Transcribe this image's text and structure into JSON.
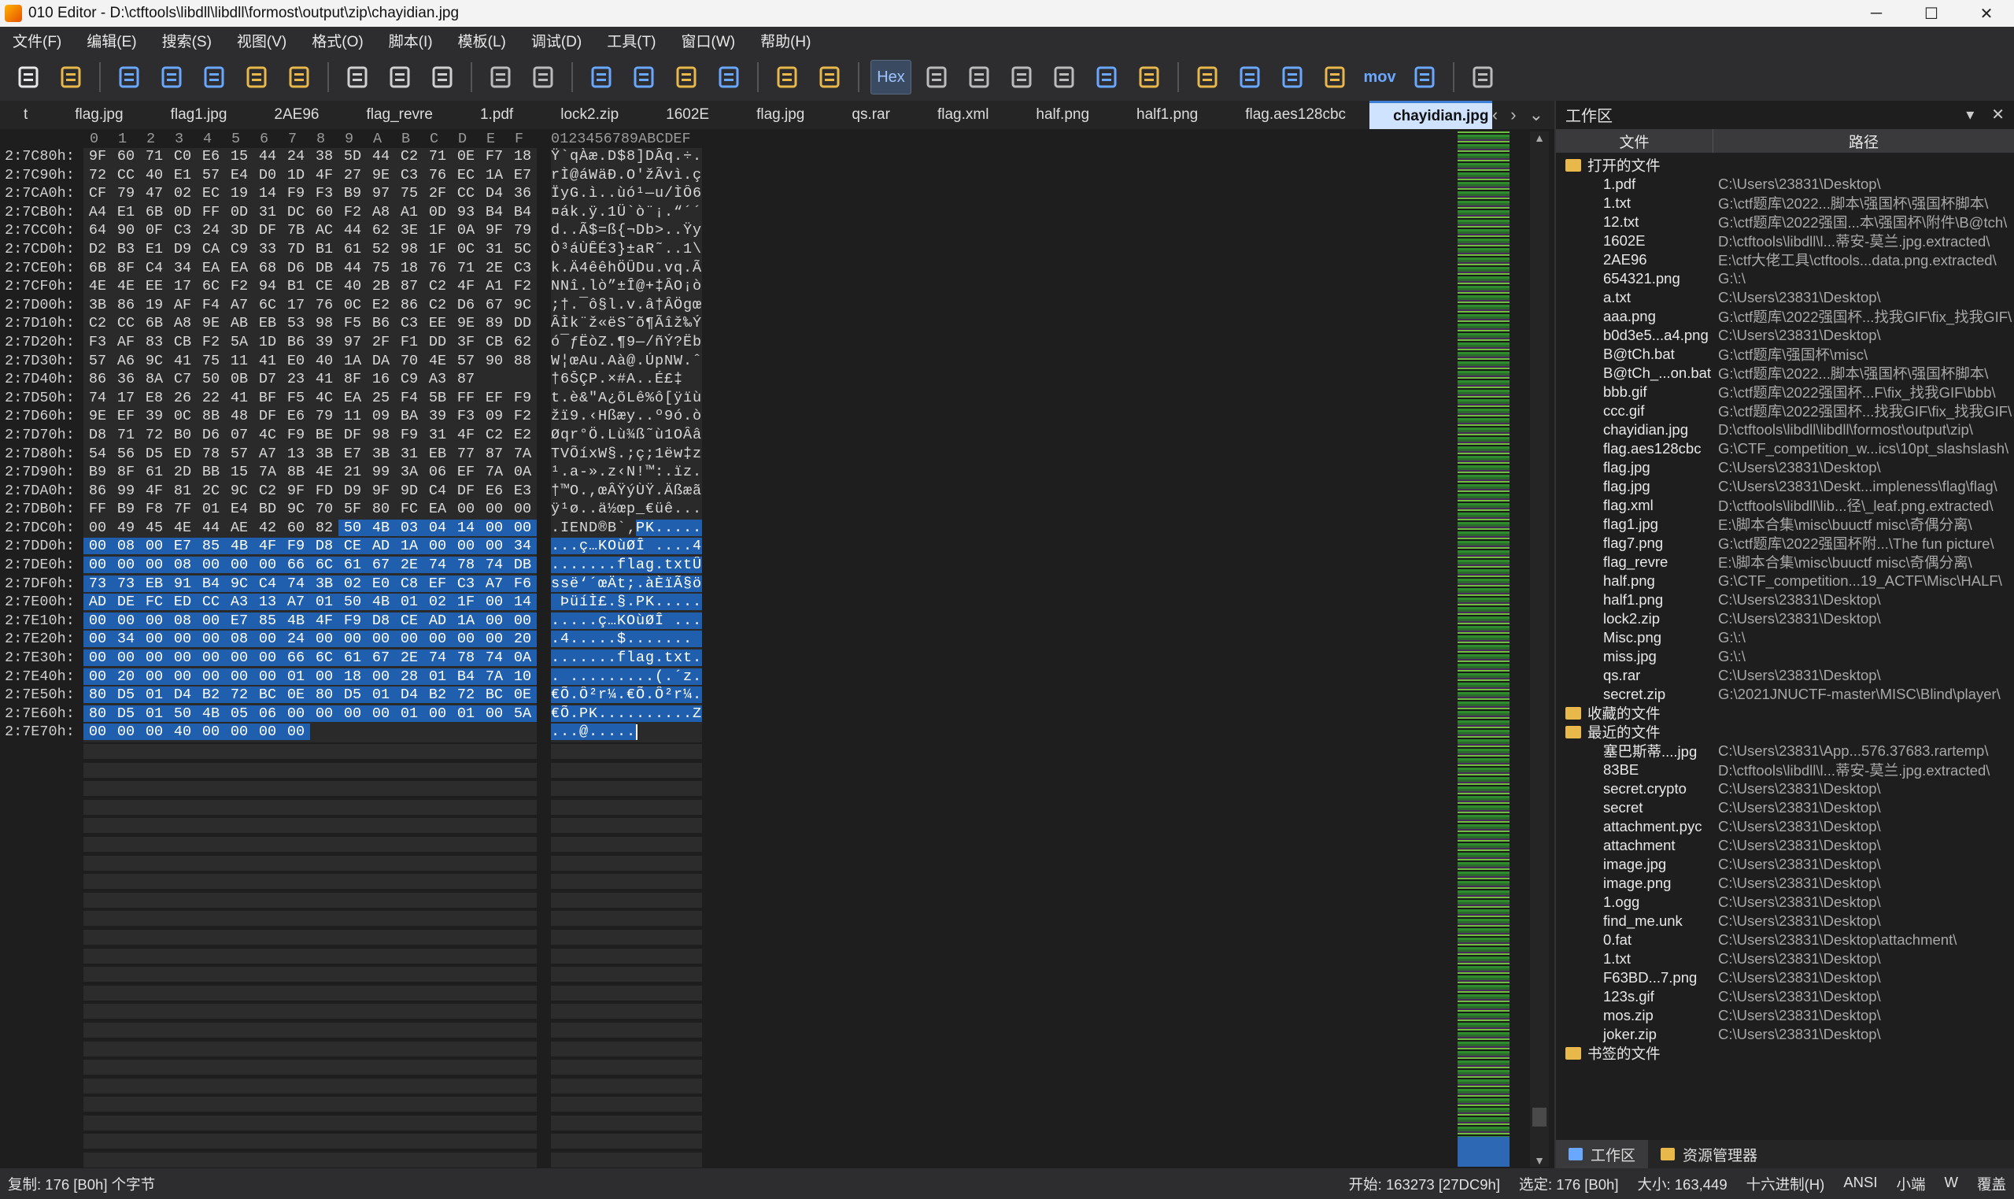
{
  "window": {
    "title": "010 Editor - D:\\ctftools\\libdll\\libdll\\formost\\output\\zip\\chayidian.jpg",
    "minimize": "─",
    "maximize": "☐",
    "close": "✕"
  },
  "menu": [
    "文件(F)",
    "编辑(E)",
    "搜索(S)",
    "视图(V)",
    "格式(O)",
    "脚本(I)",
    "模板(L)",
    "调试(D)",
    "工具(T)",
    "窗口(W)",
    "帮助(H)"
  ],
  "toolbar": {
    "hex_label": "Hex",
    "mov_label": "mov",
    "icons": [
      "new-file-icon",
      "open-folder-icon",
      "save-icon",
      "save-as-icon",
      "save-all-icon",
      "folder-icon",
      "open-workspace-icon",
      "cut-icon",
      "copy-icon",
      "paste-icon",
      "undo-icon",
      "redo-icon",
      "find-icon",
      "replace-icon",
      "goto-icon",
      "arrow-right-icon",
      "run-script-icon",
      "run-template-icon",
      "hex-mode-icon",
      "text-mode-icon",
      "paragraph-icon",
      "columns-icon",
      "highlight-icon",
      "calculator-icon",
      "inspector-icon",
      "compare-icon",
      "histogram-icon",
      "checksum-icon",
      "math-icon",
      "mov-icon",
      "base-convert-icon",
      "pause-icon"
    ]
  },
  "tabs": [
    {
      "label": "t",
      "active": false
    },
    {
      "label": "flag.jpg",
      "active": false
    },
    {
      "label": "flag1.jpg",
      "active": false
    },
    {
      "label": "2AE96",
      "active": false
    },
    {
      "label": "flag_revre",
      "active": false
    },
    {
      "label": "1.pdf",
      "active": false
    },
    {
      "label": "lock2.zip",
      "active": false
    },
    {
      "label": "1602E",
      "active": false
    },
    {
      "label": "flag.jpg",
      "active": false
    },
    {
      "label": "qs.rar",
      "active": false
    },
    {
      "label": "flag.xml",
      "active": false
    },
    {
      "label": "half.png",
      "active": false
    },
    {
      "label": "half1.png",
      "active": false
    },
    {
      "label": "flag.aes128cbc",
      "active": false
    },
    {
      "label": "chayidian.jpg",
      "active": true
    }
  ],
  "hex": {
    "column_headers": [
      "0",
      "1",
      "2",
      "3",
      "4",
      "5",
      "6",
      "7",
      "8",
      "9",
      "A",
      "B",
      "C",
      "D",
      "E",
      "F"
    ],
    "ascii_header": "0123456789ABCDEF",
    "rows": [
      {
        "addr": "2:7C80h:",
        "bytes": "9F 60 71 C0 E6 15 44 24 38 5D 44 C2 71 0E F7 18",
        "ascii": "Ÿ`qÀæ.D$8]DÂq.÷.",
        "sel_from": -1
      },
      {
        "addr": "2:7C90h:",
        "bytes": "72 CC 40 E1 57 E4 D0 1D 4F 27 9E C3 76 EC 1A E7",
        "ascii": "rÌ@áWäÐ.O'žÃvì.ç",
        "sel_from": -1
      },
      {
        "addr": "2:7CA0h:",
        "bytes": "CF 79 47 02 EC 19 14 F9 F3 B9 97 75 2F CC D4 36",
        "ascii": "ÏyG.ì..ùó¹—u/ÌÔ6",
        "sel_from": -1
      },
      {
        "addr": "2:7CB0h:",
        "bytes": "A4 E1 6B 0D FF 0D 31 DC 60 F2 A8 A1 0D 93 B4 B4",
        "ascii": "¤ák.ÿ.1Ü`ò¨¡.“´´",
        "sel_from": -1
      },
      {
        "addr": "2:7CC0h:",
        "bytes": "64 90 0F C3 24 3D DF 7B AC 44 62 3E 1F 0A 9F 79",
        "ascii": "d..Ã$=ß{¬Db>..Ÿy",
        "sel_from": -1
      },
      {
        "addr": "2:7CD0h:",
        "bytes": "D2 B3 E1 D9 CA C9 33 7D B1 61 52 98 1F 0C 31 5C",
        "ascii": "Ò³áÙÊÉ3}±aR˜..1\\",
        "sel_from": -1
      },
      {
        "addr": "2:7CE0h:",
        "bytes": "6B 8F C4 34 EA EA 68 D6 DB 44 75 18 76 71 2E C3",
        "ascii": "k.Ä4êêhÖÛDu.vq.Ã",
        "sel_from": -1
      },
      {
        "addr": "2:7CF0h:",
        "bytes": "4E 4E EE 17 6C F2 94 B1 CE 40 2B 87 C2 4F A1 F2",
        "ascii": "NNî.lò”±Î@+‡ÂO¡ò",
        "sel_from": -1
      },
      {
        "addr": "2:7D00h:",
        "bytes": "3B 86 19 AF F4 A7 6C 17 76 0C E2 86 C2 D6 67 9C",
        "ascii": ";†.¯ô§l.v.â†ÂÖgœ",
        "sel_from": -1
      },
      {
        "addr": "2:7D10h:",
        "bytes": "C2 CC 6B A8 9E AB EB 53 98 F5 B6 C3 EE 9E 89 DD",
        "ascii": "ÂÌk¨ž«ëS˜õ¶Ãîž‰Ý",
        "sel_from": -1
      },
      {
        "addr": "2:7D20h:",
        "bytes": "F3 AF 83 CB F2 5A 1D B6 39 97 2F F1 DD 3F CB 62",
        "ascii": "ó¯ƒËòZ.¶9—/ñÝ?Ëb",
        "sel_from": -1
      },
      {
        "addr": "2:7D30h:",
        "bytes": "57 A6 9C 41 75 11 41 E0 40 1A DA 70 4E 57 90 88",
        "ascii": "W¦œAu.Aà@.ÚpNW.ˆ",
        "sel_from": -1
      },
      {
        "addr": "2:7D40h:",
        "bytes": "86 36 8A C7 50 0B D7 23 41 8F 16 C9 A3 87",
        "ascii": "†6ŠÇP.×#A..É£‡",
        "sel_from": -1
      },
      {
        "addr": "2:7D50h:",
        "bytes": "74 17 E8 26 22 41 BF F5 4C EA 25 F4 5B FF EF F9",
        "ascii": "t.è&\"A¿õLê%ô[ÿïù",
        "sel_from": -1
      },
      {
        "addr": "2:7D60h:",
        "bytes": "9E EF 39 0C 8B 48 DF E6 79 11 09 BA 39 F3 09 F2",
        "ascii": "žï9.‹Hßæy..º9ó.ò",
        "sel_from": -1
      },
      {
        "addr": "2:7D70h:",
        "bytes": "D8 71 72 B0 D6 07 4C F9 BE DF 98 F9 31 4F C2 E2",
        "ascii": "Øqr°Ö.Lù¾ß˜ù1OÂâ",
        "sel_from": -1
      },
      {
        "addr": "2:7D80h:",
        "bytes": "54 56 D5 ED 78 57 A7 13 3B E7 3B 31 EB 77 87 7A",
        "ascii": "TVÕíxW§.;ç;1ëw‡z",
        "sel_from": -1
      },
      {
        "addr": "2:7D90h:",
        "bytes": "B9 8F 61 2D BB 15 7A 8B 4E 21 99 3A 06 EF 7A 0A",
        "ascii": "¹.a-».z‹N!™:.ïz.",
        "sel_from": -1
      },
      {
        "addr": "2:7DA0h:",
        "bytes": "86 99 4F 81 2C 9C C2 9F FD D9 9F 9D C4 DF E6 E3",
        "ascii": "†™O.,œÂŸýÙŸ.Äßæã",
        "sel_from": -1
      },
      {
        "addr": "2:7DB0h:",
        "bytes": "FF B9 F8 7F 01 E4 BD 9C 70 5F 80 FC EA 00 00 00",
        "ascii": "ÿ¹ø..ä½œp_€üê...",
        "sel_from": -1
      },
      {
        "addr": "2:7DC0h:",
        "bytes": "00 49 45 4E 44 AE 42 60 82 50 4B 03 04 14 00 00",
        "ascii": ".IEND®B`‚PK.....",
        "sel_from": 9
      },
      {
        "addr": "2:7DD0h:",
        "bytes": "00 08 00 E7 85 4B 4F F9 D8 CE AD 1A 00 00 00 34",
        "ascii": "...ç…KOùØÎ­....4",
        "sel_from": 0
      },
      {
        "addr": "2:7DE0h:",
        "bytes": "00 00 00 08 00 00 00 66 6C 61 67 2E 74 78 74 DB",
        "ascii": ".......flag.txtÛ",
        "sel_from": 0
      },
      {
        "addr": "2:7DF0h:",
        "bytes": "73 73 EB 91 B4 9C C4 74 3B 02 E0 C8 EF C3 A7 F6",
        "ascii": "ssë‘´œÄt;.àÈïÃ§ö",
        "sel_from": 0
      },
      {
        "addr": "2:7E00h:",
        "bytes": "AD DE FC ED CC A3 13 A7 01 50 4B 01 02 1F 00 14",
        "ascii": "­ÞüíÌ£.§.PK.....",
        "sel_from": 0
      },
      {
        "addr": "2:7E10h:",
        "bytes": "00 00 00 08 00 E7 85 4B 4F F9 D8 CE AD 1A 00 00",
        "ascii": ".....ç…KOùØÎ­...",
        "sel_from": 0
      },
      {
        "addr": "2:7E20h:",
        "bytes": "00 34 00 00 00 08 00 24 00 00 00 00 00 00 00 20",
        "ascii": ".4.....$....... ",
        "sel_from": 0
      },
      {
        "addr": "2:7E30h:",
        "bytes": "00 00 00 00 00 00 00 66 6C 61 67 2E 74 78 74 0A",
        "ascii": ".......flag.txt.",
        "sel_from": 0
      },
      {
        "addr": "2:7E40h:",
        "bytes": "00 20 00 00 00 00 00 01 00 18 00 28 01 B4 7A 10",
        "ascii": ". .........(.´z.",
        "sel_from": 0
      },
      {
        "addr": "2:7E50h:",
        "bytes": "80 D5 01 D4 B2 72 BC 0E 80 D5 01 D4 B2 72 BC 0E",
        "ascii": "€Õ.Ô²r¼.€Õ.Ô²r¼.",
        "sel_from": 0
      },
      {
        "addr": "2:7E60h:",
        "bytes": "80 D5 01 50 4B 05 06 00 00 00 00 01 00 01 00 5A",
        "ascii": "€Õ.PK..........Z",
        "sel_from": 0
      },
      {
        "addr": "2:7E70h:",
        "bytes": "00 00 00 40 00 00 00 00",
        "ascii": "...@.....",
        "sel_from": 0
      }
    ]
  },
  "workspace": {
    "title": "工作区",
    "col_name": "文件",
    "col_path": "路径",
    "open_files_label": "打开的文件",
    "open_files": [
      {
        "name": "1.pdf",
        "path": "C:\\Users\\23831\\Desktop\\"
      },
      {
        "name": "1.txt",
        "path": "G:\\ctf题库\\2022...脚本\\强国杯\\强国杯脚本\\"
      },
      {
        "name": "12.txt",
        "path": "G:\\ctf题库\\2022强国...本\\强国杯\\附件\\B@tch\\"
      },
      {
        "name": "1602E",
        "path": "D:\\ctftools\\libdll\\l...蒂安-莫兰.jpg.extracted\\"
      },
      {
        "name": "2AE96",
        "path": "E:\\ctf大佬工具\\ctftools...data.png.extracted\\"
      },
      {
        "name": "654321.png",
        "path": "G:\\:\\"
      },
      {
        "name": "a.txt",
        "path": "C:\\Users\\23831\\Desktop\\"
      },
      {
        "name": "aaa.png",
        "path": "G:\\ctf题库\\2022强国杯...找我GIF\\fix_找我GIF\\"
      },
      {
        "name": "b0d3e5...a4.png",
        "path": "C:\\Users\\23831\\Desktop\\"
      },
      {
        "name": "B@tCh.bat",
        "path": "G:\\ctf题库\\强国杯\\misc\\"
      },
      {
        "name": "B@tCh_...on.bat",
        "path": "G:\\ctf题库\\2022...脚本\\强国杯\\强国杯脚本\\"
      },
      {
        "name": "bbb.gif",
        "path": "G:\\ctf题库\\2022强国杯...F\\fix_找我GIF\\bbb\\"
      },
      {
        "name": "ccc.gif",
        "path": "G:\\ctf题库\\2022强国杯...找我GIF\\fix_找我GIF\\"
      },
      {
        "name": "chayidian.jpg",
        "path": "D:\\ctftools\\libdll\\libdll\\formost\\output\\zip\\"
      },
      {
        "name": "flag.aes128cbc",
        "path": "G:\\CTF_competition_w...ics\\10pt_slashslash\\"
      },
      {
        "name": "flag.jpg",
        "path": "C:\\Users\\23831\\Desktop\\"
      },
      {
        "name": "flag.jpg",
        "path": "C:\\Users\\23831\\Deskt...impleness\\flag\\flag\\"
      },
      {
        "name": "flag.xml",
        "path": "D:\\ctftools\\libdll\\lib...径\\_leaf.png.extracted\\"
      },
      {
        "name": "flag1.jpg",
        "path": "E:\\脚本合集\\misc\\buuctf misc\\奇偶分离\\"
      },
      {
        "name": "flag7.png",
        "path": "G:\\ctf题库\\2022强国杯附...\\The fun picture\\"
      },
      {
        "name": "flag_revre",
        "path": "E:\\脚本合集\\misc\\buuctf misc\\奇偶分离\\"
      },
      {
        "name": "half.png",
        "path": "G:\\CTF_competition...19_ACTF\\Misc\\HALF\\"
      },
      {
        "name": "half1.png",
        "path": "C:\\Users\\23831\\Desktop\\"
      },
      {
        "name": "lock2.zip",
        "path": "C:\\Users\\23831\\Desktop\\"
      },
      {
        "name": "Misc.png",
        "path": "G:\\:\\"
      },
      {
        "name": "miss.jpg",
        "path": "G:\\:\\"
      },
      {
        "name": "qs.rar",
        "path": "C:\\Users\\23831\\Desktop\\"
      },
      {
        "name": "secret.zip",
        "path": "G:\\2021JNUCTF-master\\MISC\\Blind\\player\\"
      }
    ],
    "favorites_label": "收藏的文件",
    "recent_label": "最近的文件",
    "recent_files": [
      {
        "name": "塞巴斯蒂....jpg",
        "path": "C:\\Users\\23831\\App...576.37683.rartemp\\"
      },
      {
        "name": "83BE",
        "path": "D:\\ctftools\\libdll\\l...蒂安-莫兰.jpg.extracted\\"
      },
      {
        "name": "secret.crypto",
        "path": "C:\\Users\\23831\\Desktop\\"
      },
      {
        "name": "secret",
        "path": "C:\\Users\\23831\\Desktop\\"
      },
      {
        "name": "attachment.pyc",
        "path": "C:\\Users\\23831\\Desktop\\"
      },
      {
        "name": "attachment",
        "path": "C:\\Users\\23831\\Desktop\\"
      },
      {
        "name": "image.jpg",
        "path": "C:\\Users\\23831\\Desktop\\"
      },
      {
        "name": "image.png",
        "path": "C:\\Users\\23831\\Desktop\\"
      },
      {
        "name": "1.ogg",
        "path": "C:\\Users\\23831\\Desktop\\"
      },
      {
        "name": "find_me.unk",
        "path": "C:\\Users\\23831\\Desktop\\"
      },
      {
        "name": "0.fat",
        "path": "C:\\Users\\23831\\Desktop\\attachment\\"
      },
      {
        "name": "1.txt",
        "path": "C:\\Users\\23831\\Desktop\\"
      },
      {
        "name": "F63BD...7.png",
        "path": "C:\\Users\\23831\\Desktop\\"
      },
      {
        "name": "123s.gif",
        "path": "C:\\Users\\23831\\Desktop\\"
      },
      {
        "name": "mos.zip",
        "path": "C:\\Users\\23831\\Desktop\\"
      },
      {
        "name": "joker.zip",
        "path": "C:\\Users\\23831\\Desktop\\"
      }
    ],
    "bookmarks_label": "书签的文件",
    "tab_workspace": "工作区",
    "tab_explorer": "资源管理器"
  },
  "status": {
    "left": "复制: 176 [B0h] 个字节",
    "start": "开始: 163273 [27DC9h]",
    "selection": "选定: 176 [B0h]",
    "size": "大小: 163,449",
    "mode": "十六进制(H)",
    "encoding": "ANSI",
    "endian": "小端",
    "insert": "W",
    "overwrite": "覆盖"
  }
}
